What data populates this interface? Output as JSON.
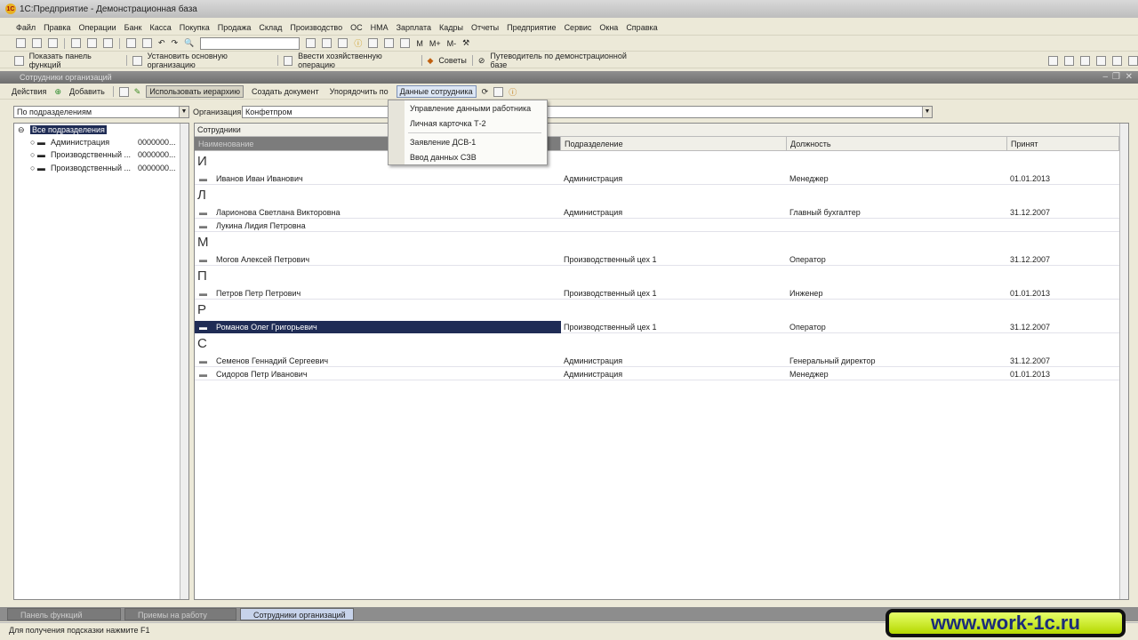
{
  "window": {
    "title": "1С:Предприятие - Демонстрационная база"
  },
  "menu": [
    "Файл",
    "Правка",
    "Операции",
    "Банк",
    "Касса",
    "Покупка",
    "Продажа",
    "Склад",
    "Производство",
    "ОС",
    "НМА",
    "Зарплата",
    "Кадры",
    "Отчеты",
    "Предприятие",
    "Сервис",
    "Окна",
    "Справка"
  ],
  "toolbar": {
    "memory": [
      "M",
      "M+",
      "M-"
    ],
    "search_value": ""
  },
  "toolbar2": [
    "Показать панель функций",
    "Установить основную организацию",
    "Ввести хозяйственную операцию",
    "Советы",
    "Путеводитель по демонстрационной базе"
  ],
  "doc": {
    "title": "Сотрудники организаций",
    "actions": {
      "actions": "Действия",
      "add": "Добавить",
      "hierarchy": "Использовать иерархию",
      "create_doc": "Создать документ",
      "order_by": "Упорядочить по",
      "employee_data": "Данные сотрудника"
    },
    "filter": {
      "grouping": "По подразделениям",
      "org_label": "Организация:",
      "org_value": "Конфетпром"
    },
    "tree": {
      "root": "Все подразделения",
      "items": [
        {
          "name": "Администрация",
          "code": "0000000..."
        },
        {
          "name": "Производственный ...",
          "code": "0000000..."
        },
        {
          "name": "Производственный ...",
          "code": "0000000..."
        }
      ]
    },
    "grid": {
      "caption": "Сотрудники",
      "columns": [
        "Наименование",
        "Подразделение",
        "Должность",
        "Принят"
      ],
      "groups": [
        {
          "letter": "И",
          "rows": [
            [
              "Иванов Иван Иванович",
              "Администрация",
              "Менеджер",
              "01.01.2013"
            ]
          ]
        },
        {
          "letter": "Л",
          "rows": [
            [
              "Ларионова Светлана Викторовна",
              "Администрация",
              "Главный бухгалтер",
              "31.12.2007"
            ],
            [
              "Лукина  Лидия Петровна",
              "",
              "",
              ""
            ]
          ]
        },
        {
          "letter": "М",
          "rows": [
            [
              "Могов Алексей Петрович",
              "Производственный цех 1",
              "Оператор",
              "31.12.2007"
            ]
          ]
        },
        {
          "letter": "П",
          "rows": [
            [
              "Петров Петр Петрович",
              "Производственный цех 1",
              "Инженер",
              "01.01.2013"
            ]
          ]
        },
        {
          "letter": "Р",
          "rows": [
            [
              "Романов Олег Григорьевич",
              "Производственный цех 1",
              "Оператор",
              "31.12.2007"
            ]
          ]
        },
        {
          "letter": "С",
          "rows": [
            [
              "Семенов Геннадий Сергеевич",
              "Администрация",
              "Генеральный директор",
              "31.12.2007"
            ],
            [
              "Сидоров Петр Иванович",
              "Администрация",
              "Менеджер",
              "01.01.2013"
            ]
          ]
        }
      ]
    },
    "dropdown": [
      "Управление данными работника",
      "Личная карточка Т-2",
      "Заявление ДСВ-1",
      "Ввод данных СЗВ"
    ]
  },
  "taskbar": [
    "Панель функций",
    "Приемы на работу",
    "Сотрудники организаций"
  ],
  "status": "Для получения подсказки нажмите F1",
  "watermark": "www.work-1c.ru"
}
